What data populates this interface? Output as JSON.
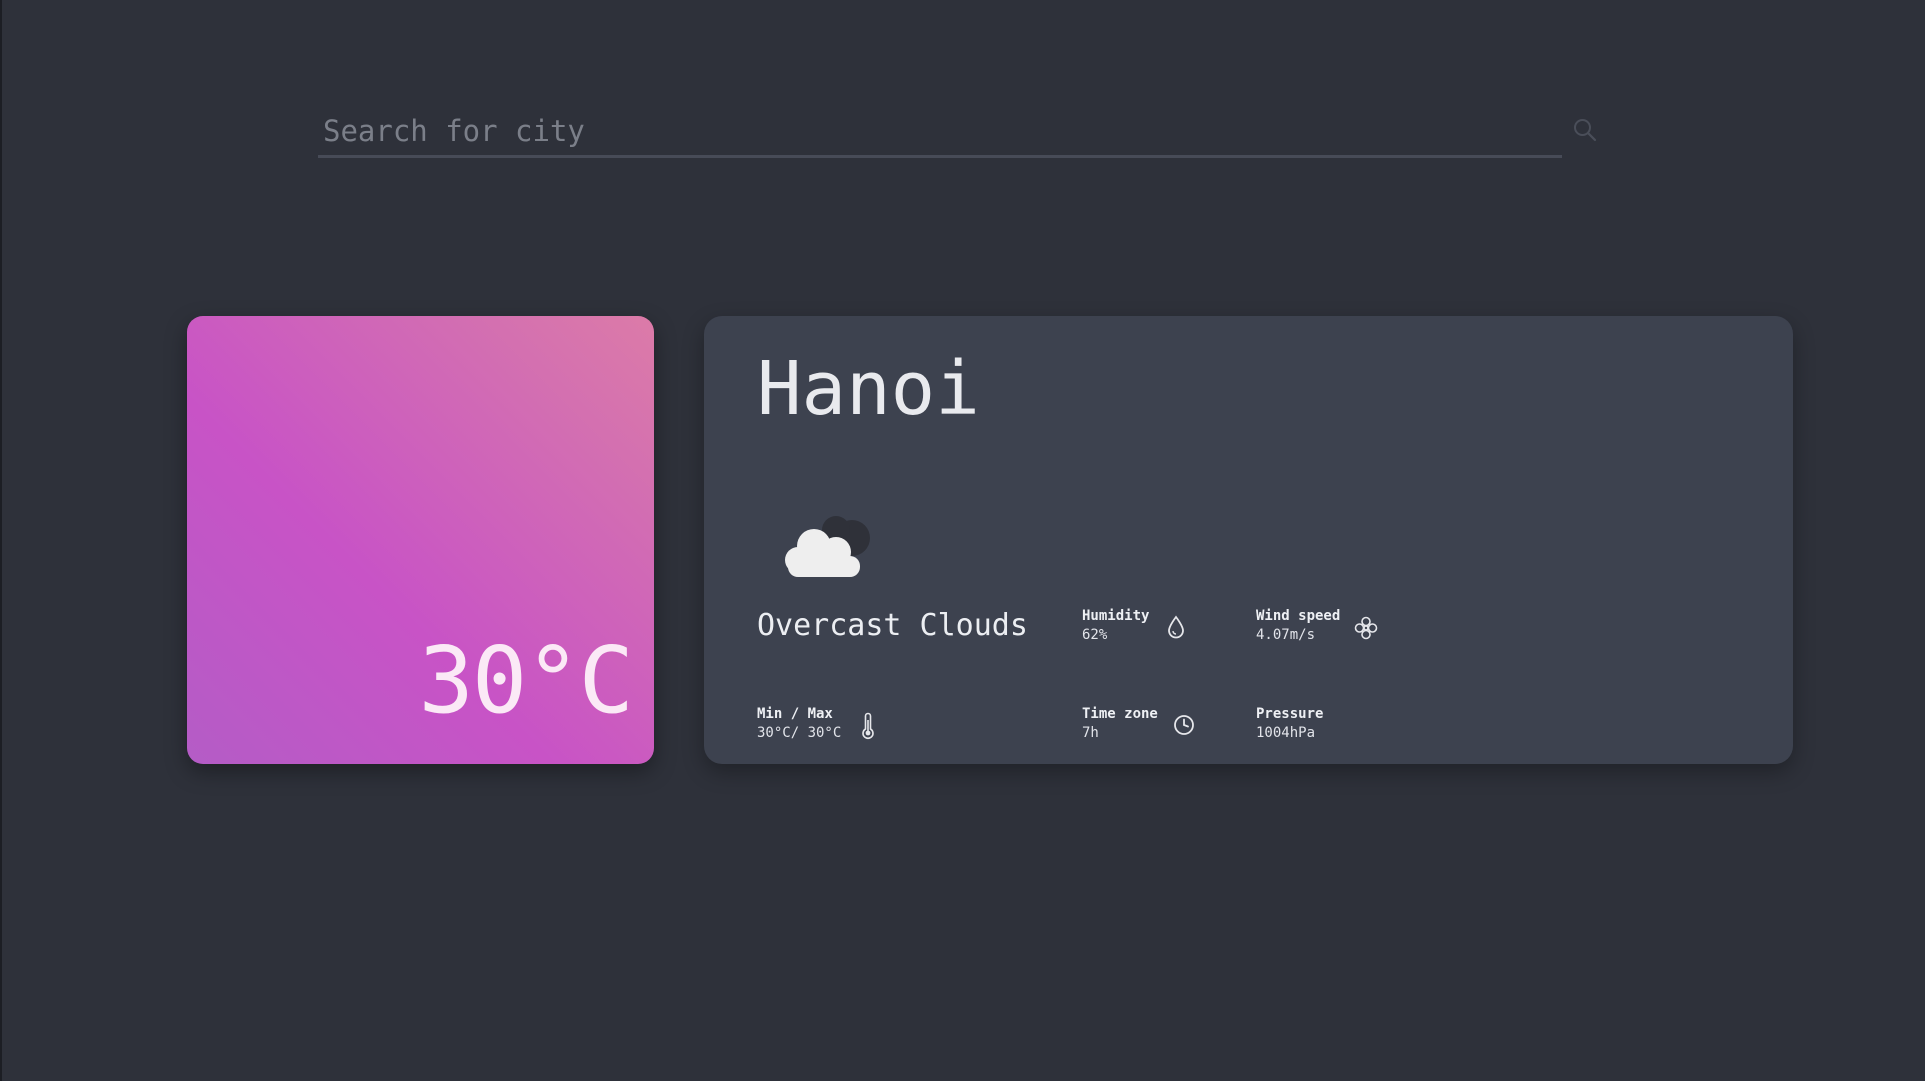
{
  "search": {
    "placeholder": "Search for city",
    "icon": "search-icon"
  },
  "temperature": {
    "value": "30°C",
    "gradient": [
      "#b45cc6",
      "#c853c6",
      "#d36fb1",
      "#dc7ba8"
    ]
  },
  "weather": {
    "city": "Hanoi",
    "icon": "cloud-icon",
    "condition": "Overcast Clouds",
    "metrics": {
      "humidity": {
        "label": "Humidity",
        "value": "62%",
        "icon": "droplet-icon"
      },
      "wind": {
        "label": "Wind speed",
        "value": "4.07m/s",
        "icon": "fan-icon"
      },
      "minmax": {
        "label": "Min / Max",
        "value": "30°C/ 30°C",
        "icon": "thermometer-icon"
      },
      "timezone": {
        "label": "Time zone",
        "value": "7h",
        "icon": "clock-icon"
      },
      "pressure": {
        "label": "Pressure",
        "value": "1004hPa"
      }
    }
  },
  "colors": {
    "background": "#2e313a",
    "card": "#3d424f",
    "text": "#e9eaee"
  }
}
